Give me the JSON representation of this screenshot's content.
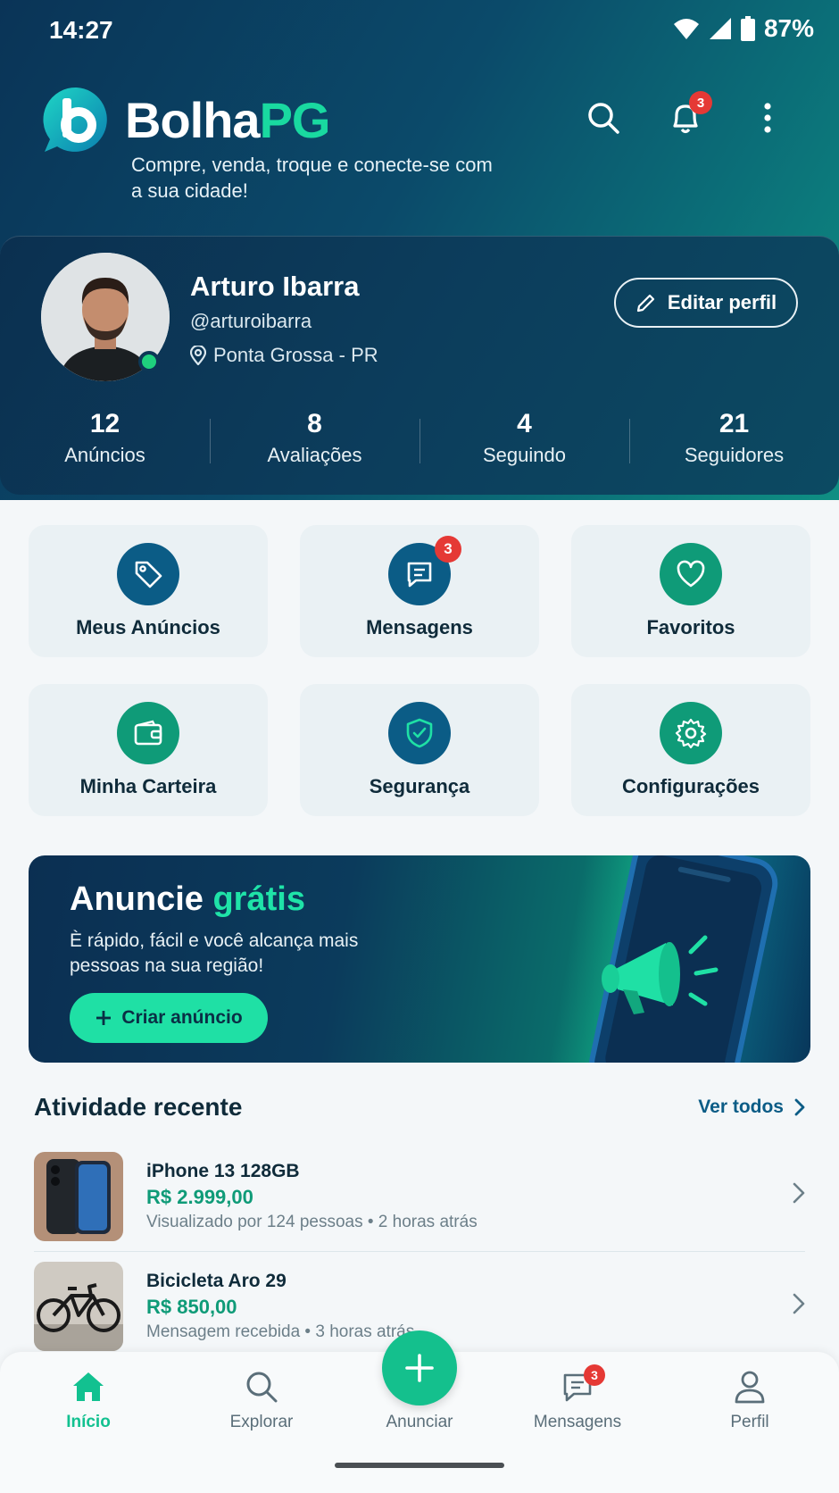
{
  "status_bar": {
    "time": "14:27",
    "battery": "87%"
  },
  "brand": {
    "name_main": "Bolha",
    "name_accent": "PG",
    "tagline": "Compre, venda, troque e conecte-se com a sua cidade!"
  },
  "header": {
    "notifications_count": "3"
  },
  "profile": {
    "name": "Arturo Ibarra",
    "handle": "@arturoibarra",
    "location": "Ponta Grossa - PR",
    "edit_label": "Editar perfil",
    "stats": [
      {
        "value": "12",
        "label": "Anúncios"
      },
      {
        "value": "8",
        "label": "Avaliações"
      },
      {
        "value": "4",
        "label": "Seguindo"
      },
      {
        "value": "21",
        "label": "Seguidores"
      }
    ]
  },
  "tiles": [
    {
      "label": "Meus Anúncios",
      "icon": "tag-icon"
    },
    {
      "label": "Mensagens",
      "icon": "message-icon",
      "badge": "3"
    },
    {
      "label": "Favoritos",
      "icon": "heart-icon"
    },
    {
      "label": "Minha Carteira",
      "icon": "wallet-icon"
    },
    {
      "label": "Segurança",
      "icon": "shield-icon"
    },
    {
      "label": "Configurações",
      "icon": "gear-icon"
    }
  ],
  "promo": {
    "title_main": "Anuncie",
    "title_accent": "grátis",
    "text": "È rápido, fácil e você alcança mais pessoas na sua região!",
    "button": "Criar anúncio"
  },
  "activity": {
    "title": "Atividade recente",
    "see_all": "Ver todos",
    "items": [
      {
        "title": "iPhone 13 128GB",
        "price": "R$ 2.999,00",
        "meta": "Visualizado por 124 pessoas • 2 horas atrás"
      },
      {
        "title": "Bicicleta Aro 29",
        "price": "R$ 850,00",
        "meta": "Mensagem recebida • 3 horas atrás"
      }
    ]
  },
  "nav": {
    "items": [
      {
        "label": "Início",
        "icon": "home-icon",
        "active": true
      },
      {
        "label": "Explorar",
        "icon": "search-icon"
      },
      {
        "label": "Anunciar",
        "icon": "plus-icon"
      },
      {
        "label": "Mensagens",
        "icon": "message-icon",
        "badge": "3"
      },
      {
        "label": "Perfil",
        "icon": "user-icon"
      }
    ]
  },
  "colors": {
    "accent": "#1fe0a5",
    "brand_dark": "#0b3050",
    "price": "#0f9b78",
    "badge": "#e53935"
  }
}
